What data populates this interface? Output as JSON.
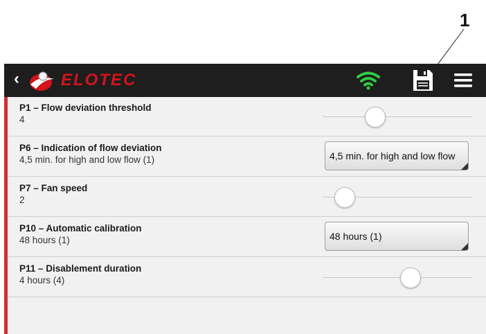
{
  "annotation": {
    "callout_number": "1"
  },
  "topbar": {
    "back_icon": "chevron-left-icon",
    "brand": "ELOTEC",
    "wifi_icon": "wifi-icon",
    "save_icon": "save-icon",
    "menu_icon": "hamburger-menu-icon",
    "colors": {
      "bar": "#1e1e1e",
      "brand_red": "#d3141a",
      "wifi_green": "#2ecc40"
    }
  },
  "settings": [
    {
      "label": "P1 – Flow deviation threshold",
      "value": "4",
      "control": "slider",
      "level": 0.35
    },
    {
      "label": "P6 – Indication of flow deviation",
      "value": "4,5 min. for high and low flow (1)",
      "control": "select",
      "selected": "4,5 min. for high and low flow"
    },
    {
      "label": "P7 – Fan speed",
      "value": "2",
      "control": "slider",
      "level": 0.15
    },
    {
      "label": "P10 – Automatic calibration",
      "value": "48 hours (1)",
      "control": "select",
      "selected": "48 hours (1)"
    },
    {
      "label": "P11 – Disablement duration",
      "value": "4 hours (4)",
      "control": "slider",
      "level": 0.59
    }
  ],
  "accent_color": "#d32f2f"
}
